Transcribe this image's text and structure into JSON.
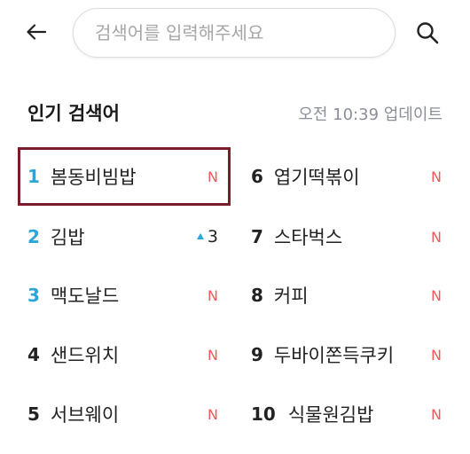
{
  "search": {
    "placeholder": "검색어를 입력해주세요"
  },
  "header": {
    "title": "인기 검색어",
    "updated": "오전 10:39 업데이트"
  },
  "ranking": [
    {
      "rank": "1",
      "term": "봄동비빔밥",
      "badge": "N",
      "change": "new"
    },
    {
      "rank": "2",
      "term": "김밥",
      "badge": "3",
      "change": "up"
    },
    {
      "rank": "3",
      "term": "맥도날드",
      "badge": "N",
      "change": "new"
    },
    {
      "rank": "4",
      "term": "샌드위치",
      "badge": "N",
      "change": "new"
    },
    {
      "rank": "5",
      "term": "서브웨이",
      "badge": "N",
      "change": "new"
    },
    {
      "rank": "6",
      "term": "엽기떡볶이",
      "badge": "N",
      "change": "new"
    },
    {
      "rank": "7",
      "term": "스타벅스",
      "badge": "N",
      "change": "new"
    },
    {
      "rank": "8",
      "term": "커피",
      "badge": "N",
      "change": "new"
    },
    {
      "rank": "9",
      "term": "두바이쫀득쿠키",
      "badge": "N",
      "change": "new"
    },
    {
      "rank": "10",
      "term": "식물원김밥",
      "badge": "N",
      "change": "new"
    }
  ],
  "colors": {
    "accent": "#2ba6d9",
    "new_badge": "#f05a5a",
    "selection_border": "#7a1c2a",
    "muted": "#8a8f99"
  },
  "icons": {
    "back": "arrow-left-icon",
    "search": "search-icon",
    "rank_up": "triangle-up-icon"
  }
}
